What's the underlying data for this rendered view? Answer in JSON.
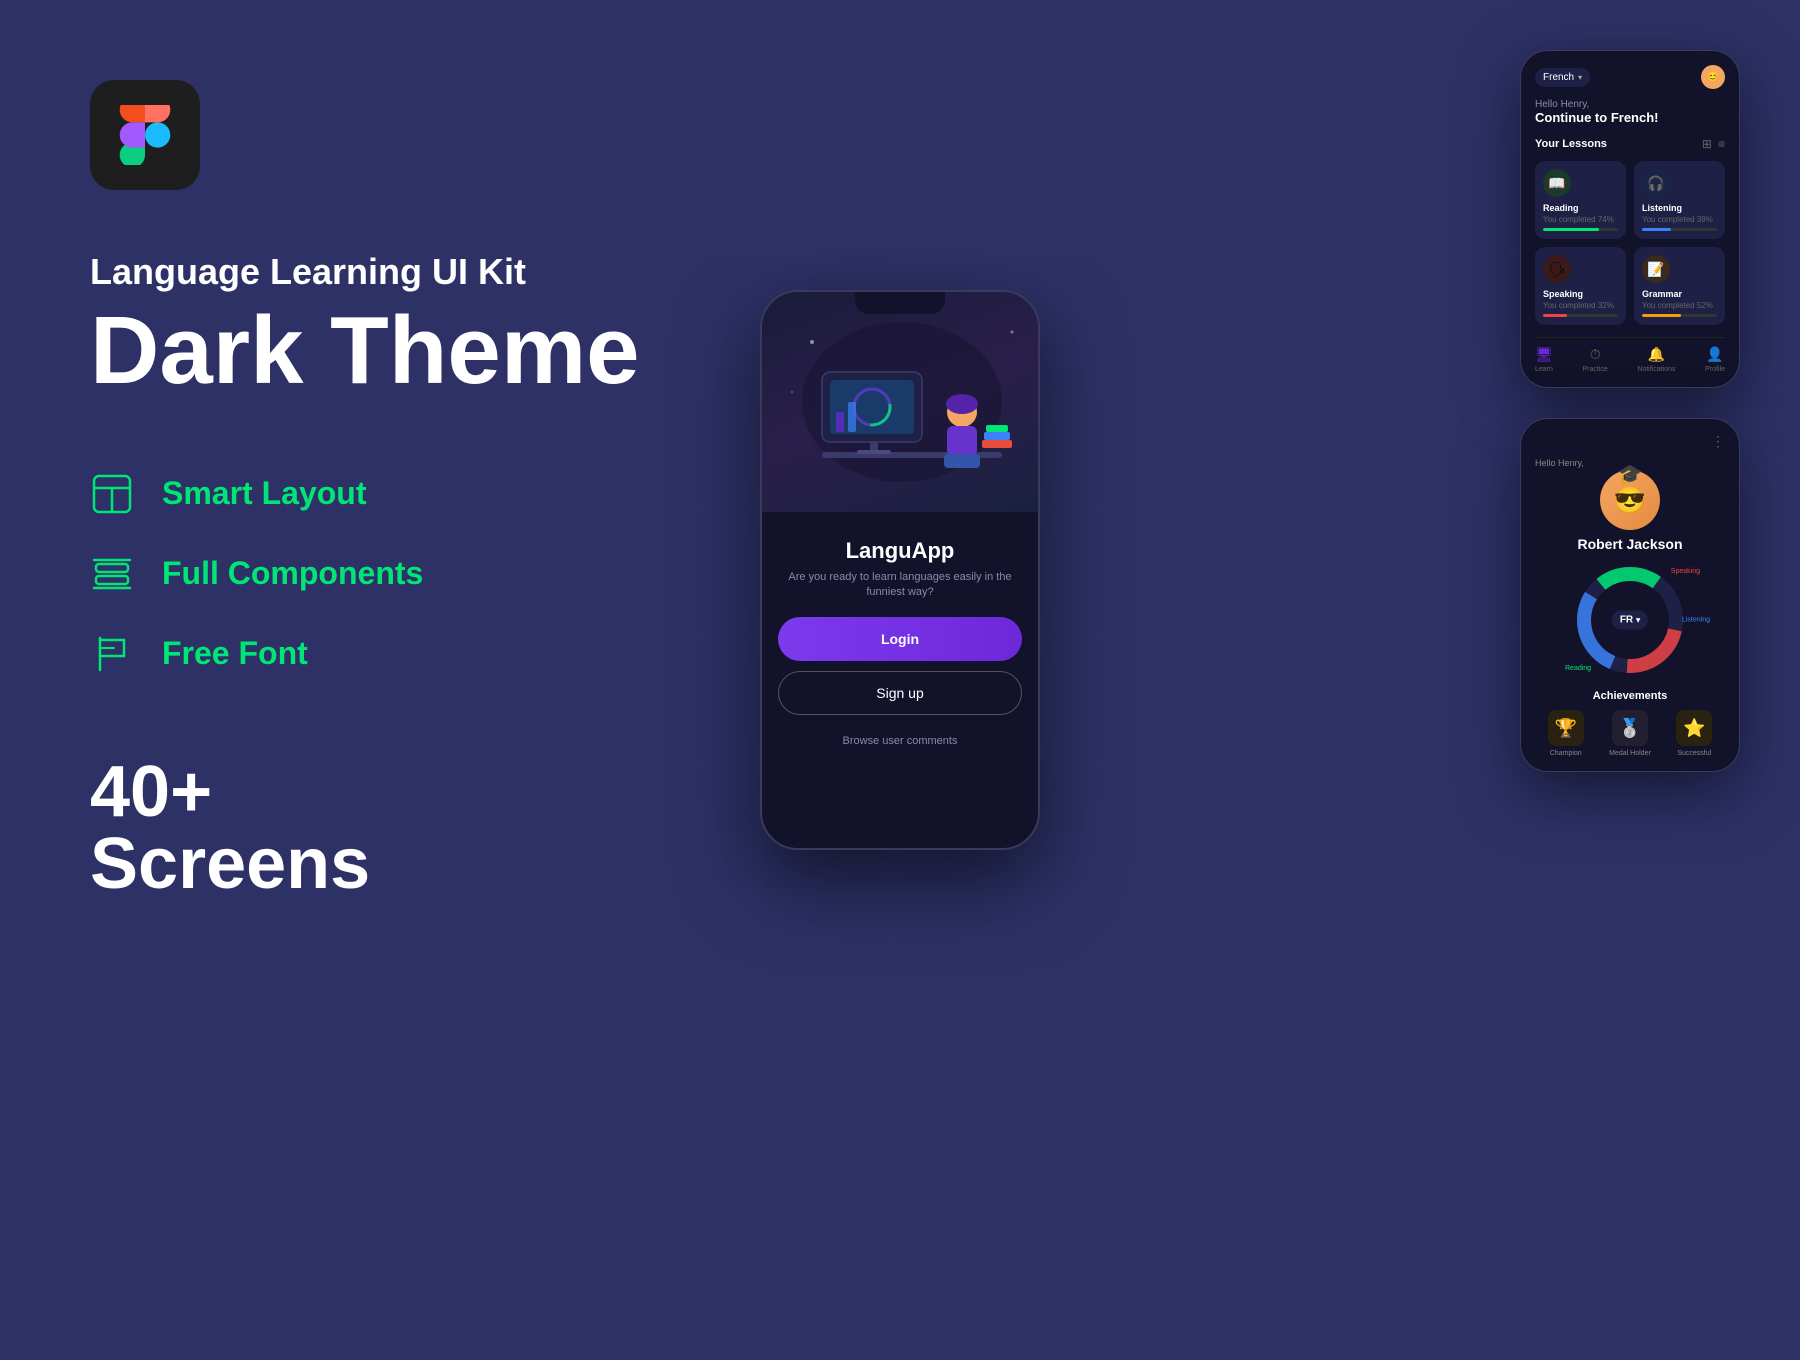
{
  "background": "#2d3166",
  "figma": {
    "logo_bg": "#1e1e1e"
  },
  "heading": {
    "subtitle": "Language Learning UI Kit",
    "title_line1": "Dark Theme"
  },
  "features": [
    {
      "id": "smart-layout",
      "label": "Smart Layout",
      "icon": "layout"
    },
    {
      "id": "full-components",
      "label": "Full Components",
      "icon": "layers"
    },
    {
      "id": "free-font",
      "label": "Free Font",
      "icon": "flag"
    }
  ],
  "screens": {
    "count": "40+",
    "label": "Screens"
  },
  "center_phone": {
    "app_name": "LanguApp",
    "tagline": "Are you ready to learn languages easily\nin the funniest way?",
    "login_label": "Login",
    "signup_label": "Sign up",
    "browse_label": "Browse user comments"
  },
  "right_phone_top": {
    "language": "French",
    "greeting_sub": "Hello Henry,",
    "greeting_main": "Continue to French!",
    "lessons_title": "Your Lessons",
    "lessons": [
      {
        "name": "Reading",
        "progress_text": "You completed 74%",
        "progress": 74,
        "color": "#00e676",
        "icon": "📖"
      },
      {
        "name": "Listening",
        "progress_text": "You completed 39%",
        "progress": 39,
        "color": "#3b82f6",
        "icon": "🎧"
      },
      {
        "name": "Speaking",
        "progress_text": "You completed 32%",
        "progress": 32,
        "color": "#ef4444",
        "icon": "🗣"
      },
      {
        "name": "Grammar",
        "progress_text": "You completed 52%",
        "progress": 52,
        "color": "#f59e0b",
        "icon": "📝"
      }
    ],
    "nav_items": [
      {
        "label": "Learn",
        "active": true
      },
      {
        "label": "Practice",
        "active": false
      },
      {
        "label": "Notifications",
        "active": false
      },
      {
        "label": "Profile",
        "active": false
      }
    ]
  },
  "right_phone_bottom": {
    "greeting": "Hello Henry,",
    "profile_name": "Robert Jackson",
    "chart_label": "FR",
    "chart_labels": [
      "Speaking",
      "Listening",
      "Reading"
    ],
    "chart_values": [
      {
        "label": "Speaking",
        "color": "#ef4444",
        "value": 65
      },
      {
        "label": "Listening",
        "color": "#3b82f6",
        "value": 80
      },
      {
        "label": "Reading",
        "color": "#00e676",
        "value": 60
      }
    ],
    "achievements_title": "Achievements",
    "achievements": [
      {
        "label": "Champion",
        "color": "#f59e0b",
        "icon": "🏆"
      },
      {
        "label": "Medal Holder",
        "color": "#c0c0c0",
        "icon": "🥈"
      },
      {
        "label": "Successful",
        "color": "#f59e0b",
        "icon": "⭐"
      }
    ]
  }
}
